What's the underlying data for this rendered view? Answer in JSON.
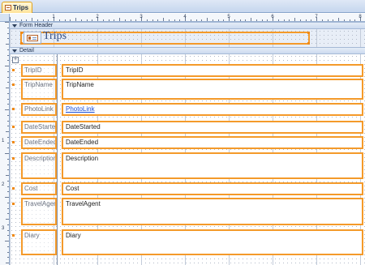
{
  "tab": {
    "title": "Trips"
  },
  "sections": {
    "header": "Form Header",
    "detail": "Detail"
  },
  "header": {
    "title": "Trips"
  },
  "ruler": {
    "h_numbers": [
      "1",
      "2",
      "3",
      "4",
      "5",
      "6",
      "7",
      "8"
    ],
    "v_numbers": [
      "1",
      "2",
      "3"
    ]
  },
  "fields": [
    {
      "label": "TripID",
      "value": "TripID",
      "is_link": false
    },
    {
      "label": "TripName",
      "value": "TripName",
      "is_link": false
    },
    {
      "label": "PhotoLink",
      "value": "PhotoLink",
      "is_link": true
    },
    {
      "label": "DateStarted",
      "value": "DateStarted",
      "is_link": false
    },
    {
      "label": "DateEnded",
      "value": "DateEnded",
      "is_link": false
    },
    {
      "label": "Description",
      "value": "Description",
      "is_link": false
    },
    {
      "label": "Cost",
      "value": "Cost",
      "is_link": false
    },
    {
      "label": "TravelAgent",
      "value": "TravelAgent",
      "is_link": false
    },
    {
      "label": "Diary",
      "value": "Diary",
      "is_link": false
    }
  ],
  "colors": {
    "selection": "#f49a2a",
    "tab_active": "#ffe39a",
    "link": "#1d4fd6"
  }
}
